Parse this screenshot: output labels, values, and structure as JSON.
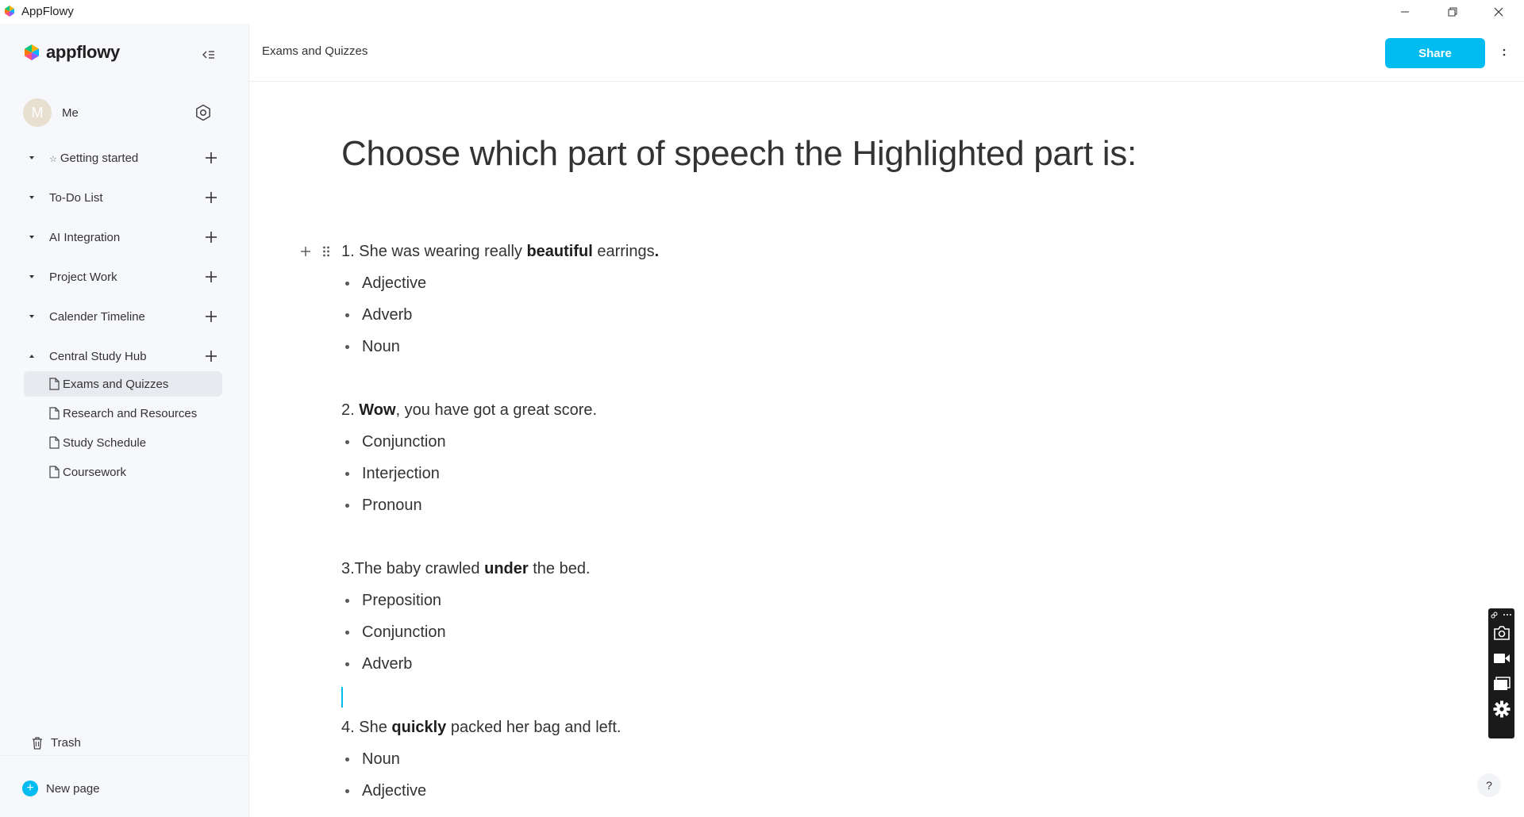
{
  "window": {
    "title": "AppFlowy"
  },
  "sidebar": {
    "logo_text": "appflowy",
    "user": {
      "initial": "M",
      "name": "Me"
    },
    "spaces": [
      {
        "label": "Getting started",
        "starred": true,
        "expanded": false
      },
      {
        "label": "To-Do List",
        "expanded": false
      },
      {
        "label": "AI Integration",
        "expanded": false
      },
      {
        "label": "Project Work",
        "expanded": false
      },
      {
        "label": "Calender Timeline",
        "expanded": false
      },
      {
        "label": "Central Study Hub",
        "expanded": true
      }
    ],
    "pages": [
      {
        "label": "Exams and Quizzes",
        "active": true
      },
      {
        "label": "Research and Resources"
      },
      {
        "label": "Study Schedule"
      },
      {
        "label": "Coursework"
      }
    ],
    "trash_label": "Trash",
    "new_page_label": "New page"
  },
  "header": {
    "breadcrumb": "Exams and Quizzes",
    "share_label": "Share"
  },
  "document": {
    "title": "Choose which part of speech the Highlighted part is:",
    "questions": [
      {
        "before": "1. She was wearing really ",
        "bold": "beautiful",
        "after": " earrings",
        "trail_bold": ".",
        "options": [
          "Adjective",
          "Adverb",
          "Noun"
        ]
      },
      {
        "before": "2. ",
        "bold": "Wow",
        "after": ", you have got a great score.",
        "options": [
          "Conjunction",
          "Interjection",
          "Pronoun"
        ]
      },
      {
        "before": "3.The baby crawled ",
        "bold": "under",
        "after": " the bed.",
        "options": [
          "Preposition",
          "Conjunction",
          "Adverb"
        ]
      },
      {
        "before": "4. She ",
        "bold": "quickly",
        "after": " packed her bag and left.",
        "options": [
          "Noun",
          "Adjective"
        ]
      }
    ]
  },
  "help_label": "?",
  "colors": {
    "accent": "#00bcf0",
    "sidebar_bg": "#f7f8fc",
    "text": "#333333"
  }
}
